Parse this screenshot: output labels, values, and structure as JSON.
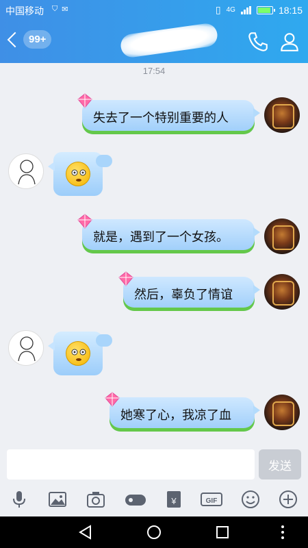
{
  "status_bar": {
    "carrier": "中国移动",
    "network": "4G",
    "time": "18:15"
  },
  "header": {
    "unread_badge": "99+",
    "contact_name": "",
    "icons": [
      "back-icon",
      "phone-icon",
      "contact-icon"
    ]
  },
  "timestamp": "17:54",
  "messages": [
    {
      "sender": "me",
      "type": "text",
      "text": "失去了一个特别重要的人"
    },
    {
      "sender": "them",
      "type": "sticker",
      "sticker": "confused-face-emoji"
    },
    {
      "sender": "me",
      "type": "text",
      "text": "就是，遇到了一个女孩。"
    },
    {
      "sender": "me",
      "type": "text",
      "text": "然后，辜负了情谊"
    },
    {
      "sender": "them",
      "type": "sticker",
      "sticker": "confused-face-emoji"
    },
    {
      "sender": "me",
      "type": "text",
      "text": "她寒了心，我凉了血"
    }
  ],
  "composer": {
    "placeholder": "",
    "value": "",
    "send_label": "发送"
  },
  "toolbar_icons": [
    "mic-icon",
    "image-icon",
    "camera-icon",
    "red-packet-icon",
    "money-icon",
    "gif-icon",
    "emoji-icon",
    "plus-icon"
  ],
  "nav_icons": [
    "nav-back-icon",
    "nav-home-icon",
    "nav-recents-icon",
    "nav-menu-icon"
  ],
  "colors": {
    "header_start": "#3f8fe6",
    "header_end": "#2fa9ef",
    "bubble_top": "#cfe8ff",
    "bubble_bottom": "#9ccdfa",
    "bubble_accent": "#64c84a",
    "background": "#eef0f4"
  }
}
